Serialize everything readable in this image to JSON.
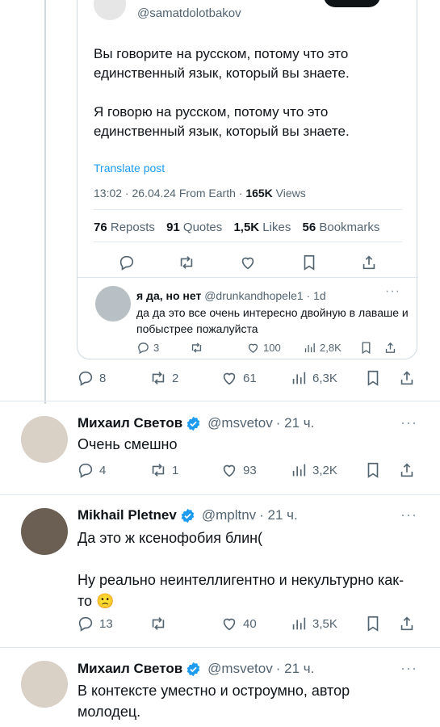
{
  "quoted_post": {
    "handle": "@samatdolotbakov",
    "paragraph1": "Вы говорите на русском, потому что это единственный язык, который вы знаете.",
    "paragraph2": "Я говорю на русском, потому что это единственный язык, который вы знаете.",
    "translate_label": "Translate post",
    "meta_prefix": "13:02 · 26.04.24 From Earth · ",
    "views_count": "165K",
    "views_label": " Views",
    "stats": {
      "reposts_count": "76",
      "reposts_label": " Reposts",
      "quotes_count": "91",
      "quotes_label": " Quotes",
      "likes_count": "1,5K",
      "likes_label": " Likes",
      "bookmarks_count": "56",
      "bookmarks_label": " Bookmarks"
    },
    "reply": {
      "name": "я да, но нет",
      "handle_time": "@drunkandhopele1 · 1d",
      "text": "да да это все очень интересно двойную в лаваше и побыстрее пожалуйста",
      "replies": "3",
      "likes": "100",
      "views": "2,8K"
    }
  },
  "quote_tweet_actions": {
    "replies": "8",
    "reposts": "2",
    "likes": "61",
    "views": "6,3K"
  },
  "tweets": [
    {
      "name": "Михаил Светов",
      "handle": "@msvetov",
      "time": "· 21 ч.",
      "text1": "Очень смешно",
      "replies": "4",
      "reposts": "1",
      "likes": "93",
      "views": "3,2K"
    },
    {
      "name": "Mikhail Pletnev",
      "handle": "@mpltnv",
      "time": "· 21 ч.",
      "text1": "Да это ж ксенофобия блин(",
      "text2": "Ну реально неинтеллигентно и некультурно как-то 🙁",
      "replies": "13",
      "reposts": "",
      "likes": "40",
      "views": "3,5K"
    },
    {
      "name": "Михаил Светов",
      "handle": "@msvetov",
      "time": "· 21 ч.",
      "text1": "В контексте уместно и остроумно, автор молодец."
    }
  ],
  "colors": {
    "accent": "#1d9bf0",
    "muted": "#536471",
    "text": "#0f1419",
    "border": "#cfd9de"
  }
}
